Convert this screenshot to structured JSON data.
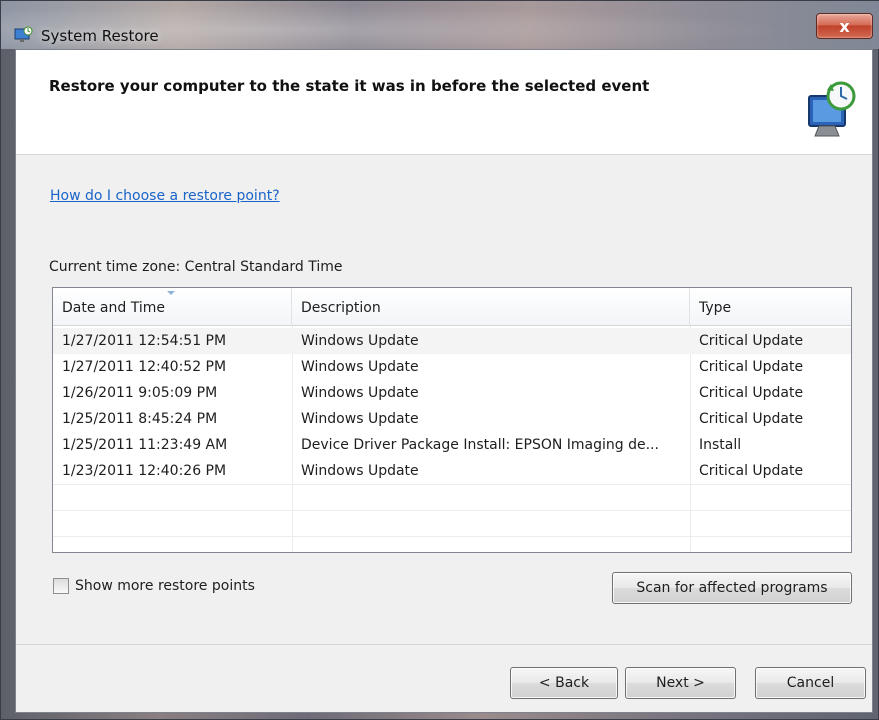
{
  "window": {
    "title": "System Restore",
    "close_label": "x"
  },
  "header": {
    "title": "Restore your computer to the state it was in before the selected event"
  },
  "help_link": "How do I choose a restore point?",
  "timezone": "Current time zone: Central Standard Time",
  "table": {
    "columns": [
      "Date and Time",
      "Description",
      "Type"
    ],
    "rows": [
      [
        "1/27/2011 12:54:51 PM",
        "Windows Update",
        "Critical Update"
      ],
      [
        "1/27/2011 12:40:52 PM",
        "Windows Update",
        "Critical Update"
      ],
      [
        "1/26/2011 9:05:09 PM",
        "Windows Update",
        "Critical Update"
      ],
      [
        "1/25/2011 8:45:24 PM",
        "Windows Update",
        "Critical Update"
      ],
      [
        "1/25/2011 11:23:49 AM",
        "Device Driver Package Install: EPSON Imaging de...",
        "Install"
      ],
      [
        "1/23/2011 12:40:26 PM",
        "Windows Update",
        "Critical Update"
      ]
    ]
  },
  "show_more": {
    "label": "Show more restore points",
    "checked": false
  },
  "buttons": {
    "scan": "Scan for affected programs",
    "back": "< Back",
    "next": "Next >",
    "cancel": "Cancel"
  }
}
